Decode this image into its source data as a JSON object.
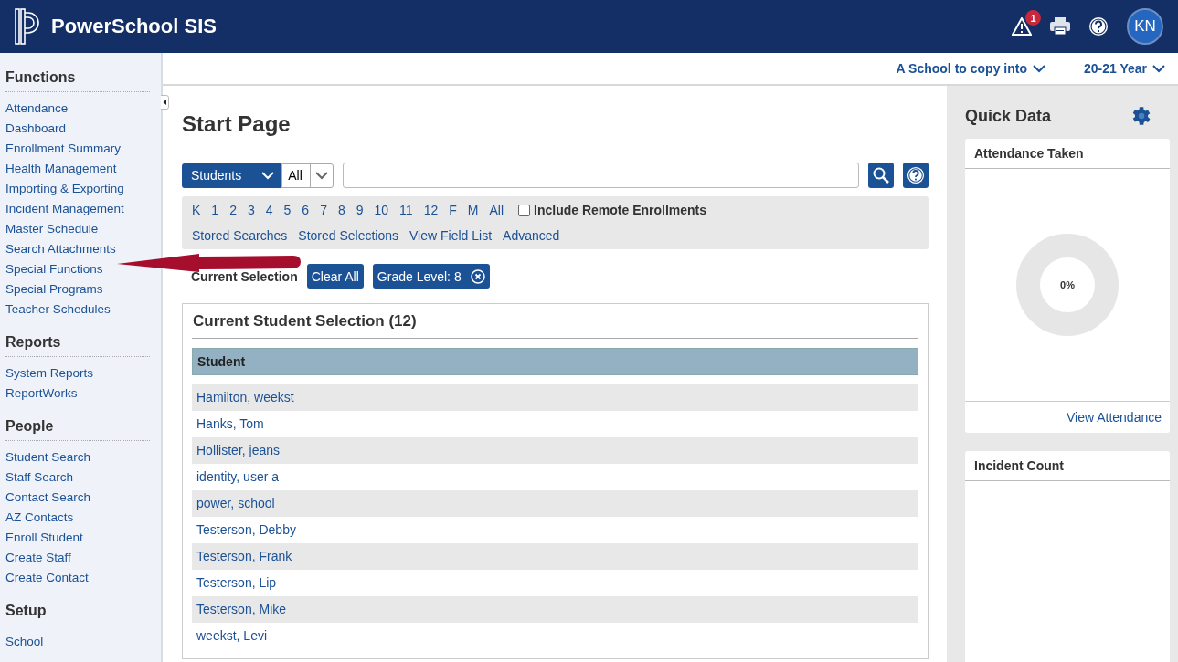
{
  "header": {
    "product": "PowerSchool SIS",
    "alert_count": "1",
    "avatar": "KN"
  },
  "sidebar": {
    "sections": [
      {
        "title": "Functions",
        "items": [
          "Attendance",
          "Dashboard",
          "Enrollment Summary",
          "Health Management",
          "Importing & Exporting",
          "Incident Management",
          "Master Schedule",
          "Search Attachments",
          "Special Functions",
          "Special Programs",
          "Teacher Schedules"
        ]
      },
      {
        "title": "Reports",
        "items": [
          "System Reports",
          "ReportWorks"
        ]
      },
      {
        "title": "People",
        "items": [
          "Student Search",
          "Staff Search",
          "Contact Search",
          "AZ Contacts",
          "Enroll Student",
          "Create Staff",
          "Create Contact"
        ]
      },
      {
        "title": "Setup",
        "items": [
          "School"
        ]
      }
    ]
  },
  "context_bar": {
    "school": "A School to copy into",
    "term": "20-21 Year"
  },
  "page_title": "Start Page",
  "search": {
    "category": "Students",
    "scope": "All"
  },
  "grade_links": [
    "K",
    "1",
    "2",
    "3",
    "4",
    "5",
    "6",
    "7",
    "8",
    "9",
    "10",
    "11",
    "12",
    "F",
    "M",
    "All"
  ],
  "include_remote": {
    "label": "Include Remote Enrollments",
    "checked": false
  },
  "search_links": [
    "Stored Searches",
    "Stored Selections",
    "View Field List",
    "Advanced"
  ],
  "current_selection": {
    "label": "Current Selection",
    "clear": "Clear All",
    "filters": [
      "Grade Level: 8"
    ]
  },
  "selection_table": {
    "title": "Current Student Selection (12)",
    "column": "Student",
    "rows": [
      "Hamilton, weekst",
      "Hanks, Tom",
      "Hollister, jeans",
      "identity, user a",
      "power, school",
      "Testerson, Debby",
      "Testerson, Frank",
      "Testerson, Lip",
      "Testerson, Mike",
      "weekst, Levi"
    ]
  },
  "quick_data": {
    "title": "Quick Data",
    "cards": [
      {
        "kind": "donut",
        "title": "Attendance Taken",
        "center": "0%",
        "link": "View Attendance"
      },
      {
        "kind": "empty",
        "title": "Incident Count"
      }
    ]
  }
}
